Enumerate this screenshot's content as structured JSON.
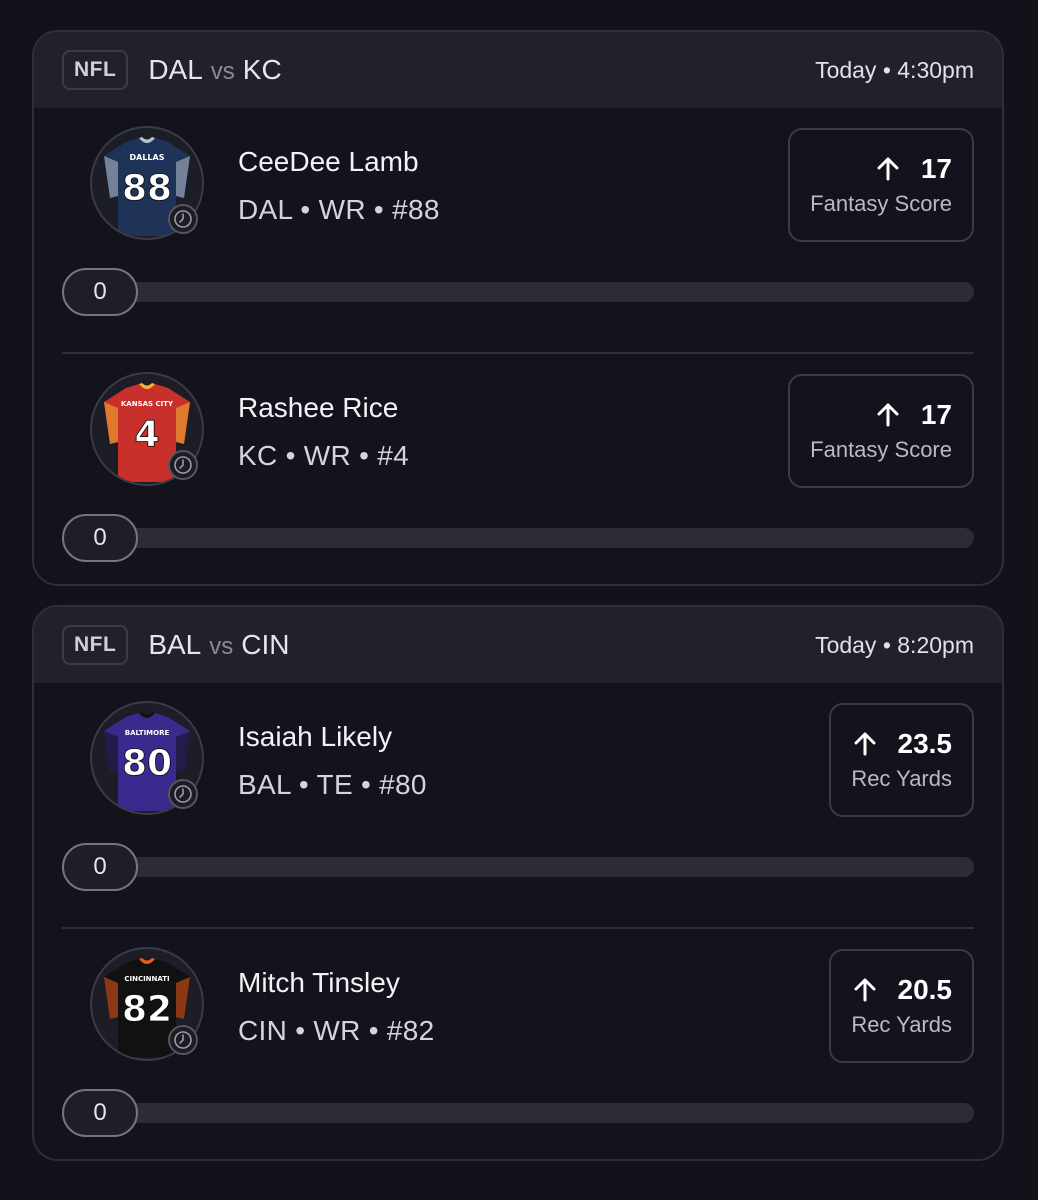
{
  "games": [
    {
      "league": "NFL",
      "home": "DAL",
      "vs": "vs",
      "away": "KC",
      "time": "Today • 4:30pm",
      "players": [
        {
          "name": "CeeDee Lamb",
          "info": "DAL • WR • #88",
          "jersey_number": "88",
          "jersey_team": "DALLAS",
          "jersey_color": "#1f3358",
          "trim_color": "#b9c2d0",
          "line": "17",
          "stat": "Fantasy Score",
          "progress_value": "0"
        },
        {
          "name": "Rashee Rice",
          "info": "KC • WR • #4",
          "jersey_number": "4",
          "jersey_team": "KANSAS CITY",
          "jersey_color": "#c8302c",
          "trim_color": "#f2b632",
          "line": "17",
          "stat": "Fantasy Score",
          "progress_value": "0"
        }
      ]
    },
    {
      "league": "NFL",
      "home": "BAL",
      "vs": "vs",
      "away": "CIN",
      "time": "Today • 8:20pm",
      "players": [
        {
          "name": "Isaiah Likely",
          "info": "BAL • TE • #80",
          "jersey_number": "80",
          "jersey_team": "BALTIMORE",
          "jersey_color": "#3a2a8e",
          "trim_color": "#111111",
          "line": "23.5",
          "stat": "Rec Yards",
          "progress_value": "0"
        },
        {
          "name": "Mitch Tinsley",
          "info": "CIN • WR • #82",
          "jersey_number": "82",
          "jersey_team": "CINCINNATI",
          "jersey_color": "#111111",
          "trim_color": "#f05a1a",
          "line": "20.5",
          "stat": "Rec Yards",
          "progress_value": "0"
        }
      ]
    }
  ],
  "icons": {
    "arrow": "arrow-up-icon",
    "clock": "clock-icon",
    "jersey": "jersey-icon"
  }
}
